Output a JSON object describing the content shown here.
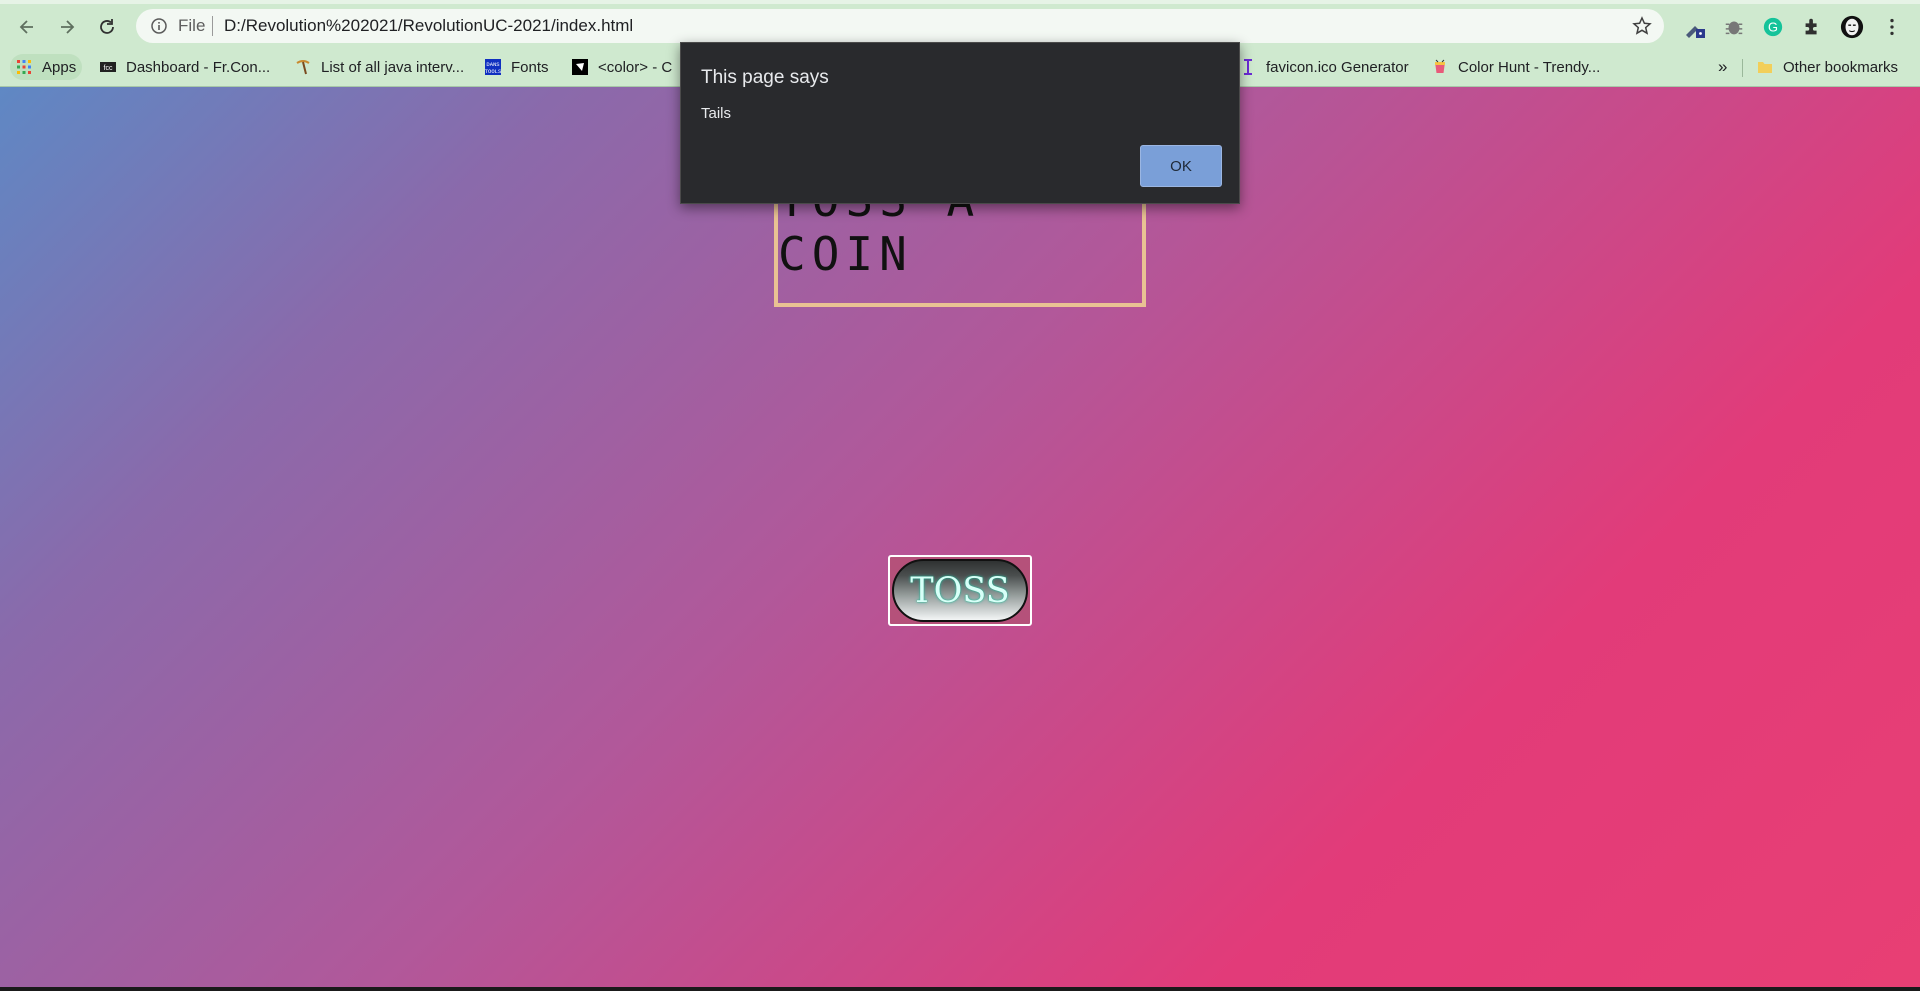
{
  "browser": {
    "address_bar": {
      "scheme_label": "File",
      "url": "D:/Revolution%202021/RevolutionUC-2021/index.html"
    },
    "bookmarks": [
      {
        "label": "Apps",
        "icon": "apps-grid-icon"
      },
      {
        "label": "Dashboard - Fr.Con...",
        "icon": "site-favicon"
      },
      {
        "label": "List of all java interv...",
        "icon": "pickaxe-icon"
      },
      {
        "label": "Fonts",
        "icon": "fonts-favicon"
      },
      {
        "label": "<color> - C",
        "icon": "mdn-favicon"
      },
      {
        "label": "favicon.ico Generator",
        "icon": "text-cursor-icon"
      },
      {
        "label": "Color Hunt - Trendy...",
        "icon": "cup-icon"
      }
    ],
    "overflow_label": "»",
    "other_bookmarks_label": "Other bookmarks"
  },
  "page": {
    "title": "TOSS A COIN",
    "toss_button_label": "TOSS",
    "gradient_colors": [
      "#5f88c4",
      "#b1589a",
      "#e83f74"
    ]
  },
  "dialog": {
    "title": "This page says",
    "message": "Tails",
    "ok_label": "OK"
  }
}
